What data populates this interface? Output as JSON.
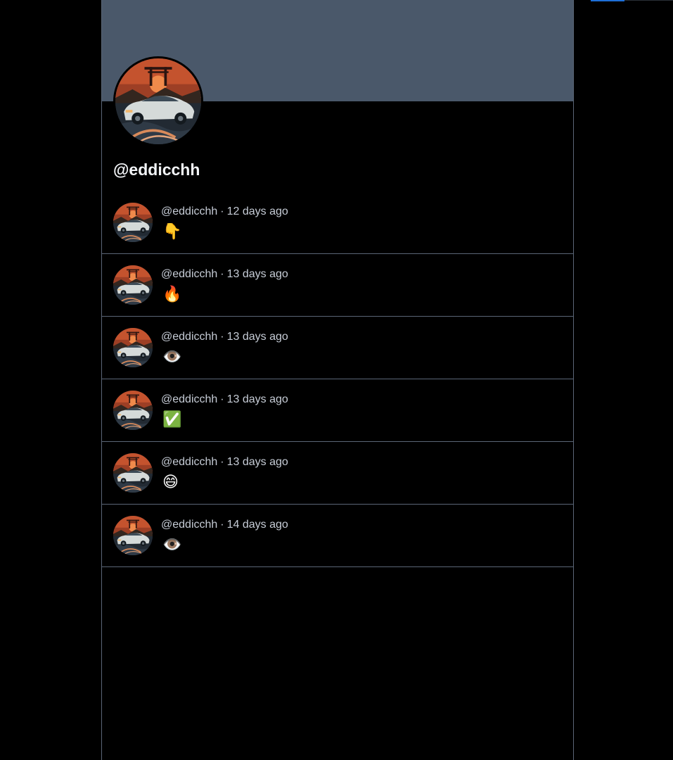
{
  "profile": {
    "handle": "@eddicchh",
    "avatar_icon": "sports-car-sunset-avatar",
    "banner_color": "#4a586a"
  },
  "posts": [
    {
      "author": "@eddicchh",
      "separator": "·",
      "time": "12 days ago",
      "content": "👇"
    },
    {
      "author": "@eddicchh",
      "separator": "·",
      "time": "13 days ago",
      "content": "🔥"
    },
    {
      "author": "@eddicchh",
      "separator": "·",
      "time": "13 days ago",
      "content": "👁️"
    },
    {
      "author": "@eddicchh",
      "separator": "·",
      "time": "13 days ago",
      "content": "✅"
    },
    {
      "author": "@eddicchh",
      "separator": "·",
      "time": "13 days ago",
      "content": "😄"
    },
    {
      "author": "@eddicchh",
      "separator": "·",
      "time": "14 days ago",
      "content": "👁️"
    }
  ],
  "colors": {
    "background": "#000000",
    "border": "#5b6677",
    "meta_text": "#c6ccd6",
    "accent": "#1d6fd8"
  }
}
